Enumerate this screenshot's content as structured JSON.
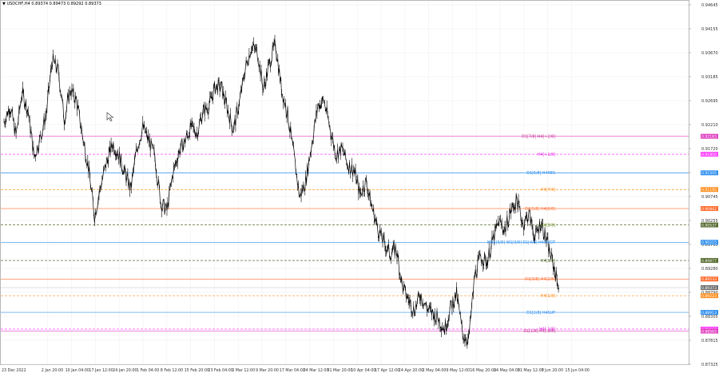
{
  "header": {
    "symbol": "USDCHF,H4",
    "quote": "0.89374 0.89473 0.89292 0.89373"
  },
  "price_axis": {
    "labels": [
      "0.94645",
      "0.94155",
      "0.93670",
      "0.93185",
      "0.92695",
      "0.92210",
      "0.91720",
      "0.91230",
      "0.90745",
      "0.90255",
      "0.89765",
      "0.89280",
      "0.88790",
      "0.88305",
      "0.87815",
      "0.87325"
    ]
  },
  "time_axis": {
    "labels": [
      "23 Dec 2022",
      "2 Jan 20:00",
      "10 Jan 04:00",
      "17 Jan 12:00",
      "24 Jan 20:00",
      "1 Feb 04:00",
      "8 Feb 12:00",
      "15 Feb 20:00",
      "23 Feb 04:00",
      "2 Mar 12:00",
      "9 Mar 20:00",
      "17 Mar 04:00",
      "24 Mar 12:00",
      "31 Mar 20:00",
      "10 Apr 04:00",
      "17 Apr 12:00",
      "24 Apr 20:00",
      "2 May 04:00",
      "9 May 12:00",
      "16 May 20:00",
      "24 May 04:00",
      "31 May 12:00",
      "7 Jun 20:00",
      "15 Jun 04:00"
    ]
  },
  "levels": [
    {
      "label": "D1[7/8] H4[+2/8]",
      "price_tag": "0.92183",
      "color": "#e040c0",
      "dash": "solid",
      "label_color": "#c03090"
    },
    {
      "label": "H4[+1/8]",
      "price_tag": "0.91850",
      "color": "#ff40ff",
      "dash": "dashed",
      "label_color": "#e020e0"
    },
    {
      "label": "D1[6/8] H4RES",
      "price_tag": "0.91505",
      "color": "#2f8ff0",
      "dash": "solid",
      "label_color": "#2f8ff0"
    },
    {
      "label": "H4[7/8]",
      "price_tag": "0.91195",
      "color": "#ff9020",
      "dash": "dashed",
      "label_color": "#ff9020"
    },
    {
      "label": "D1[5/8] H4[6/8]",
      "price_tag": "0.90842",
      "color": "#ff6a2a",
      "dash": "solid",
      "label_color": "#ff6a2a"
    },
    {
      "label": "H4[5/8]",
      "price_tag": "0.90537",
      "color": "#556b2f",
      "dash": "dashed",
      "label_color": "#6b8e23"
    },
    {
      "label": "MN1[5/8] W1[3/8] D1[4/8] H4PIVOT",
      "price_tag": "0.90215",
      "color": "#2f8ff0",
      "dash": "solid",
      "label_color": "#2f8ff0"
    },
    {
      "label": "H4[3/8]",
      "price_tag": "0.89877",
      "color": "#556b2f",
      "dash": "dashed",
      "label_color": "#556b2f"
    },
    {
      "label": "D1[3/8] H4[2/8]",
      "price_tag": "0.89533",
      "color": "#ff6a2a",
      "dash": "solid",
      "label_color": "#ff6a2a"
    },
    {
      "label": "H4[1/8]",
      "price_tag": "0.89223",
      "color": "#ff9020",
      "dash": "dashed",
      "label_color": "#ff9020"
    },
    {
      "label": "D1[2/8] H4SUP",
      "price_tag": "0.88913",
      "color": "#2f8ff0",
      "dash": "solid",
      "label_color": "#2f8ff0"
    },
    {
      "label": "H4[-1/8]",
      "price_tag": "0.88603",
      "color": "#ff40ff",
      "dash": "dashed",
      "label_color": "#e020e0"
    },
    {
      "label": "D1[1/8] H4[-2/8]",
      "price_tag": "0.88565",
      "color": "#e040c0",
      "dash": "solid",
      "label_color": "#c03090"
    }
  ],
  "current_price_tag": "0.89373",
  "chart_data": {
    "type": "line",
    "ylim": [
      0.8795,
      0.947
    ],
    "close_series": [
      0.9245,
      0.9275,
      0.922,
      0.93,
      0.9265,
      0.918,
      0.9215,
      0.926,
      0.936,
      0.934,
      0.925,
      0.9305,
      0.9285,
      0.922,
      0.916,
      0.907,
      0.9125,
      0.917,
      0.9205,
      0.9185,
      0.915,
      0.912,
      0.9195,
      0.9235,
      0.921,
      0.918,
      0.9095,
      0.908,
      0.915,
      0.919,
      0.921,
      0.9235,
      0.9225,
      0.9265,
      0.9275,
      0.931,
      0.931,
      0.927,
      0.923,
      0.928,
      0.9345,
      0.9385,
      0.9375,
      0.9305,
      0.9355,
      0.939,
      0.9305,
      0.926,
      0.9185,
      0.9105,
      0.9135,
      0.9205,
      0.9275,
      0.9285,
      0.9235,
      0.9185,
      0.9195,
      0.9165,
      0.9155,
      0.911,
      0.9135,
      0.9085,
      0.9045,
      0.902,
      0.9,
      0.901,
      0.894,
      0.8915,
      0.8895,
      0.8925,
      0.89,
      0.889,
      0.888,
      0.886,
      0.89,
      0.8925,
      0.885,
      0.884,
      0.896,
      0.8995,
      0.8985,
      0.9025,
      0.906,
      0.9045,
      0.908,
      0.91,
      0.9055,
      0.9075,
      0.903,
      0.906,
      0.902,
      0.898,
      0.8935
    ]
  }
}
